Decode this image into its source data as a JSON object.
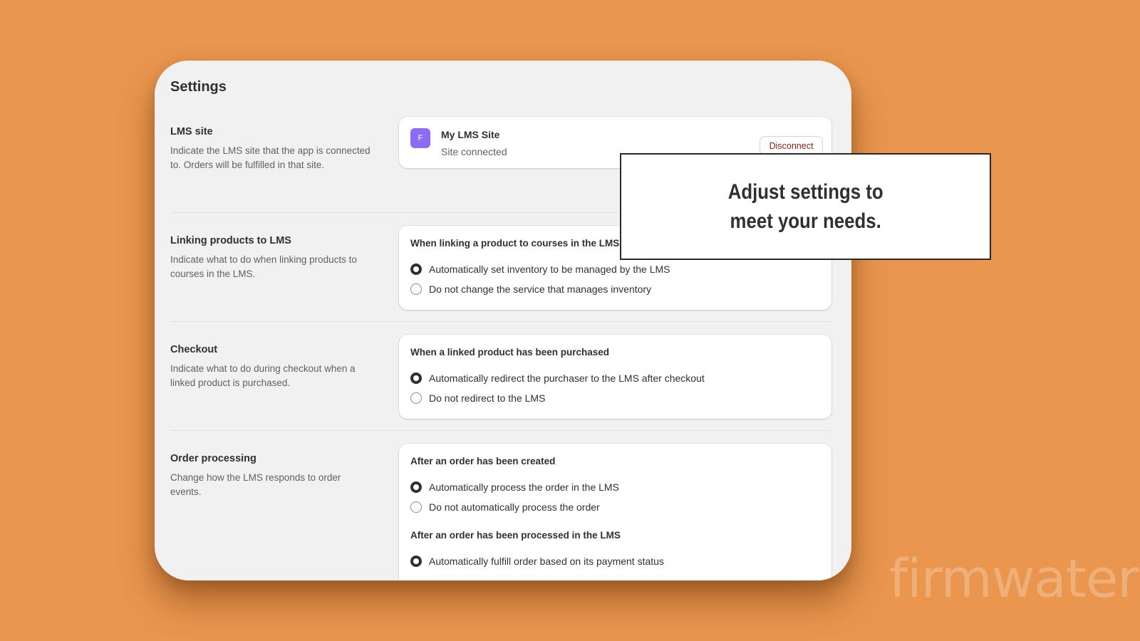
{
  "page": {
    "title": "Settings"
  },
  "sections": {
    "lms_site": {
      "heading": "LMS site",
      "description": "Indicate the LMS site that the app is connected to. Orders will be fulfilled in that site.",
      "site_initial": "F",
      "site_name": "My LMS Site",
      "site_status": "Site connected",
      "disconnect_label": "Disconnect"
    },
    "linking": {
      "heading": "Linking products to LMS",
      "description": "Indicate what to do when linking products to courses in the LMS.",
      "group_title": "When linking a product to courses in the LMS",
      "options": [
        {
          "label": "Automatically set inventory to be managed by the LMS",
          "checked": true
        },
        {
          "label": "Do not change the service that manages inventory",
          "checked": false
        }
      ]
    },
    "checkout": {
      "heading": "Checkout",
      "description": "Indicate what to do during checkout when a linked product is purchased.",
      "group_title": "When a linked product has been purchased",
      "options": [
        {
          "label": "Automatically redirect the purchaser to the LMS after checkout",
          "checked": true
        },
        {
          "label": "Do not redirect to the LMS",
          "checked": false
        }
      ]
    },
    "order_processing": {
      "heading": "Order processing",
      "description": "Change how the LMS responds to order events.",
      "group1_title": "After an order has been created",
      "group1_options": [
        {
          "label": "Automatically process the order in the LMS",
          "checked": true
        },
        {
          "label": "Do not automatically process the order",
          "checked": false
        }
      ],
      "group2_title": "After an order has been processed in the LMS",
      "group2_options": [
        {
          "label": "Automatically fulfill order based on its payment status",
          "checked": true
        }
      ]
    }
  },
  "callout": {
    "text": "Adjust settings to\nmeet your needs."
  },
  "watermark": {
    "text": "firmwater"
  },
  "colors": {
    "background": "#ea964e",
    "panel": "#f1f1f1",
    "avatar": "#8c6cf4",
    "critical_text": "#8e1f0b"
  }
}
